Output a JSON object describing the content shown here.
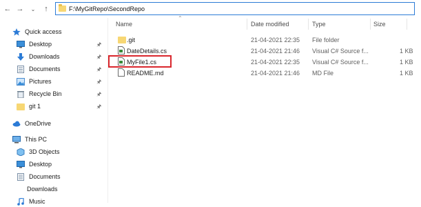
{
  "address": {
    "path": "F:\\MyGitRepo\\SecondRepo"
  },
  "sidebar": {
    "items": [
      {
        "label": "Quick access",
        "icon": "star-icon",
        "pinned": false
      },
      {
        "label": "Desktop",
        "icon": "desktop-icon",
        "pinned": true
      },
      {
        "label": "Downloads",
        "icon": "download-arrow-icon",
        "pinned": true
      },
      {
        "label": "Documents",
        "icon": "documents-icon",
        "pinned": true
      },
      {
        "label": "Pictures",
        "icon": "pictures-icon",
        "pinned": true
      },
      {
        "label": "Recycle Bin",
        "icon": "recycle-bin-icon",
        "pinned": true
      },
      {
        "label": "git 1",
        "icon": "folder-icon",
        "pinned": true
      },
      {
        "label": "OneDrive",
        "icon": "cloud-icon",
        "pinned": false
      },
      {
        "label": "This PC",
        "icon": "computer-icon",
        "pinned": false
      },
      {
        "label": "3D Objects",
        "icon": "cube-icon",
        "pinned": false
      },
      {
        "label": "Desktop",
        "icon": "desktop-icon",
        "pinned": false
      },
      {
        "label": "Documents",
        "icon": "documents-icon",
        "pinned": false
      },
      {
        "label": "Downloads",
        "icon": "download-arrow-icon",
        "pinned": false
      },
      {
        "label": "Music",
        "icon": "music-icon",
        "pinned": false
      }
    ]
  },
  "columns": {
    "name": "Name",
    "date": "Date modified",
    "type": "Type",
    "size": "Size"
  },
  "files": [
    {
      "name": ".git",
      "date": "21-04-2021 22:35",
      "type": "File folder",
      "size": "",
      "icon": "folder-icon"
    },
    {
      "name": "DateDetails.cs",
      "date": "21-04-2021 21:46",
      "type": "Visual C# Source f...",
      "size": "1 KB",
      "icon": "csharp-file-icon"
    },
    {
      "name": "MyFile1.cs",
      "date": "21-04-2021 22:35",
      "type": "Visual C# Source f...",
      "size": "1 KB",
      "icon": "csharp-file-icon"
    },
    {
      "name": "README.md",
      "date": "21-04-2021 21:46",
      "type": "MD File",
      "size": "1 KB",
      "icon": "document-icon"
    }
  ],
  "colors": {
    "highlight": "#d9262c",
    "folder": "#f7d774",
    "accent": "#2b7bd6"
  }
}
